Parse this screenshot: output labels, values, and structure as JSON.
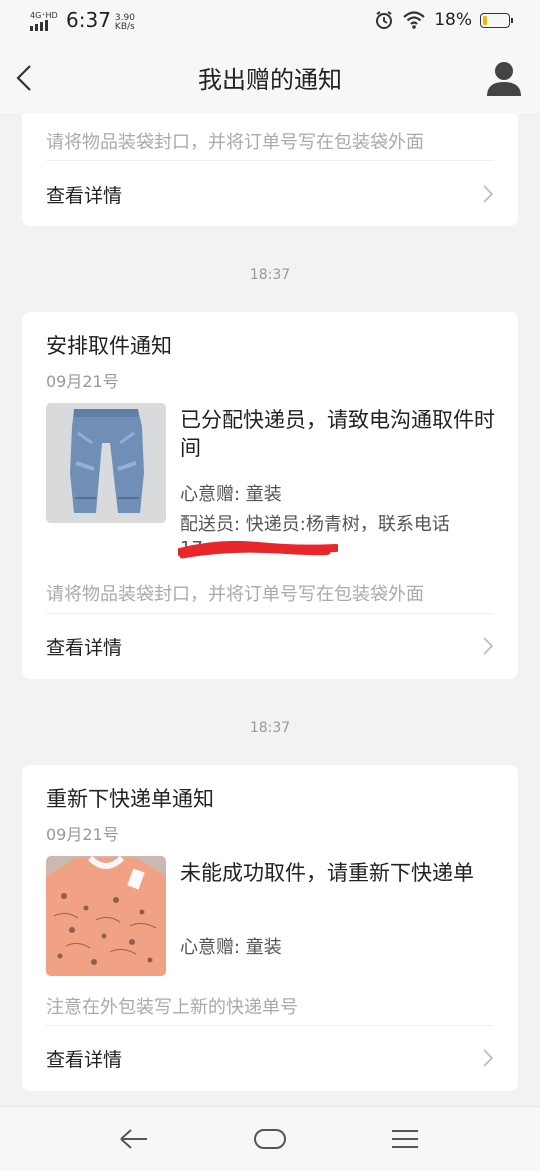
{
  "status_bar": {
    "network": "4G⁺HD",
    "time": "6:37",
    "speed_value": "3.90",
    "speed_unit": "KB/s",
    "battery_percent": "18%",
    "battery_level": 0.18,
    "icons": [
      "signal-icon",
      "alarm-icon",
      "wifi-icon",
      "battery-icon"
    ]
  },
  "header": {
    "title": "我出赠的通知",
    "back_icon": "chevron-left-icon",
    "user_icon": "user-icon"
  },
  "notifications": [
    {
      "note": "请将物品装袋封口，并将订单号写在包装袋外面",
      "details_label": "查看详情"
    },
    {
      "timestamp": "18:37",
      "title": "安排取件通知",
      "date": "09月21号",
      "thumbnail": "jeans-photo",
      "message": "已分配快递员，请致电沟通取件时间",
      "item": "心意赠: 童装",
      "courier_line": "配送员: 快递员:杨青树，联系电话",
      "phone_prefix": "17",
      "note": "请将物品装袋封口，并将订单号写在包装袋外面",
      "details_label": "查看详情"
    },
    {
      "timestamp": "18:37",
      "title": "重新下快递单通知",
      "date": "09月21号",
      "thumbnail": "tshirt-photo",
      "message": "未能成功取件，请重新下快递单",
      "item": "心意赠: 童装",
      "note": "注意在外包装写上新的快递单号",
      "details_label": "查看详情"
    }
  ],
  "nav_bar": {
    "icons": [
      "back-icon",
      "home-icon",
      "menu-icon"
    ]
  },
  "colors": {
    "background": "#f2f2f2",
    "card": "#ffffff",
    "redaction": "#e8262b",
    "battery_fill": "#f2b705"
  }
}
